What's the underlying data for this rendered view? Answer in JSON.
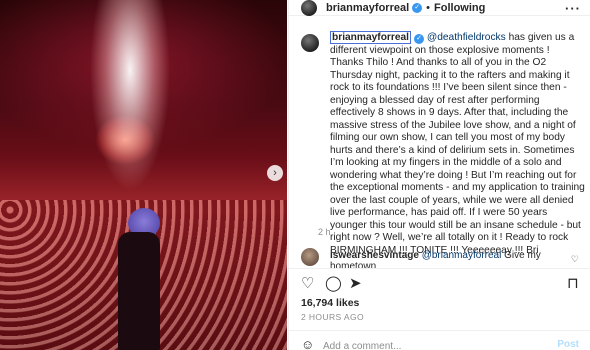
{
  "post": {
    "username": "brianmayforreal",
    "follow_dot": "•",
    "follow_label": "Following",
    "more_icon": "more-icon",
    "caption_username": "brianmayforreal",
    "caption_mention": "@deathfieldrocks",
    "caption_body": " has given us a different viewpoint on those explosive moments ! Thanks Thilo ! And thanks to all of you in the O2 Thursday night, packing it to the rafters and making it rock to its foundations !!! I’ve been silent since then - enjoying a blessed day of rest after performing effectively 8 shows in 9 days. After that, including the massive stress of the Jubilee love show, and a night of filming our own show, I can tell you most of my body hurts and there’s a kind of delirium sets in. Sometimes I’m looking at my fingers in the middle of a solo and wondering what they’re doing ! But I’m reaching out for the exceptional moments - and my application to training over the last couple of years, while we were all denied live performance, has paid off. If I were 50 years younger this tour would still be an insane schedule - but right now ? Well, we’re all totally on it ! Ready to rock BIRMINGHAM !!! TONITE !!! Yeeeeeeay !!! Bri",
    "time_ago": "2 h",
    "likes": "16,794 likes",
    "posted": "2 HOURS AGO"
  },
  "comment": {
    "username": "iswearshesvintage",
    "mention": "@brianmayforreal",
    "text": " Give my hometown"
  },
  "add_comment": {
    "placeholder": "Add a comment...",
    "post_label": "Post"
  },
  "colors": {
    "verified": "#3897f0",
    "mention": "#00376b",
    "post_button": "#b2dffc"
  }
}
